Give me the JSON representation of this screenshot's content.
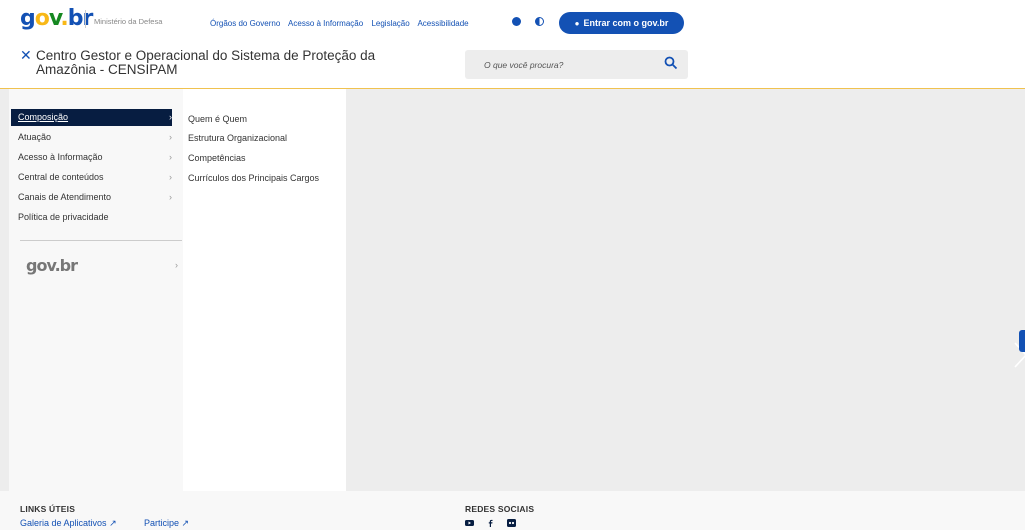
{
  "header": {
    "logo": {
      "g": "g",
      "o": "o",
      "v": "v",
      "dot": ".",
      "br": "br"
    },
    "ministry": "Ministério da Defesa",
    "top_links": [
      "Órgãos do Governo",
      "Acesso à Informação",
      "Legislação",
      "Acessibilidade"
    ],
    "cookie_icon": "cookie-icon",
    "contrast_icon": "contrast-icon",
    "login_label": "Entrar com o gov.br",
    "site_title": "Centro Gestor e Operacional do Sistema de Proteção da Amazônia - CENSIPAM",
    "search_placeholder": "O que você procura?",
    "accent": "#1351b4"
  },
  "menu": {
    "level1": [
      {
        "label": "Composição",
        "active": true
      },
      {
        "label": "Atuação"
      },
      {
        "label": "Acesso à Informação"
      },
      {
        "label": "Central de conteúdos"
      },
      {
        "label": "Canais de Atendimento"
      },
      {
        "label": "Política de privacidade"
      }
    ],
    "govbr_logo": "gov.br",
    "level2": [
      "Quem é Quem",
      "Estrutura Organizacional",
      "Competências",
      "Currículos dos Principais Cargos"
    ]
  },
  "footer": {
    "links_heading": "LINKS ÚTEIS",
    "links": [
      "Galeria de Aplicativos",
      "Participe"
    ],
    "social_heading": "REDES SOCIAIS",
    "social_icons": [
      "youtube-icon",
      "facebook-icon",
      "flickr-icon"
    ]
  }
}
